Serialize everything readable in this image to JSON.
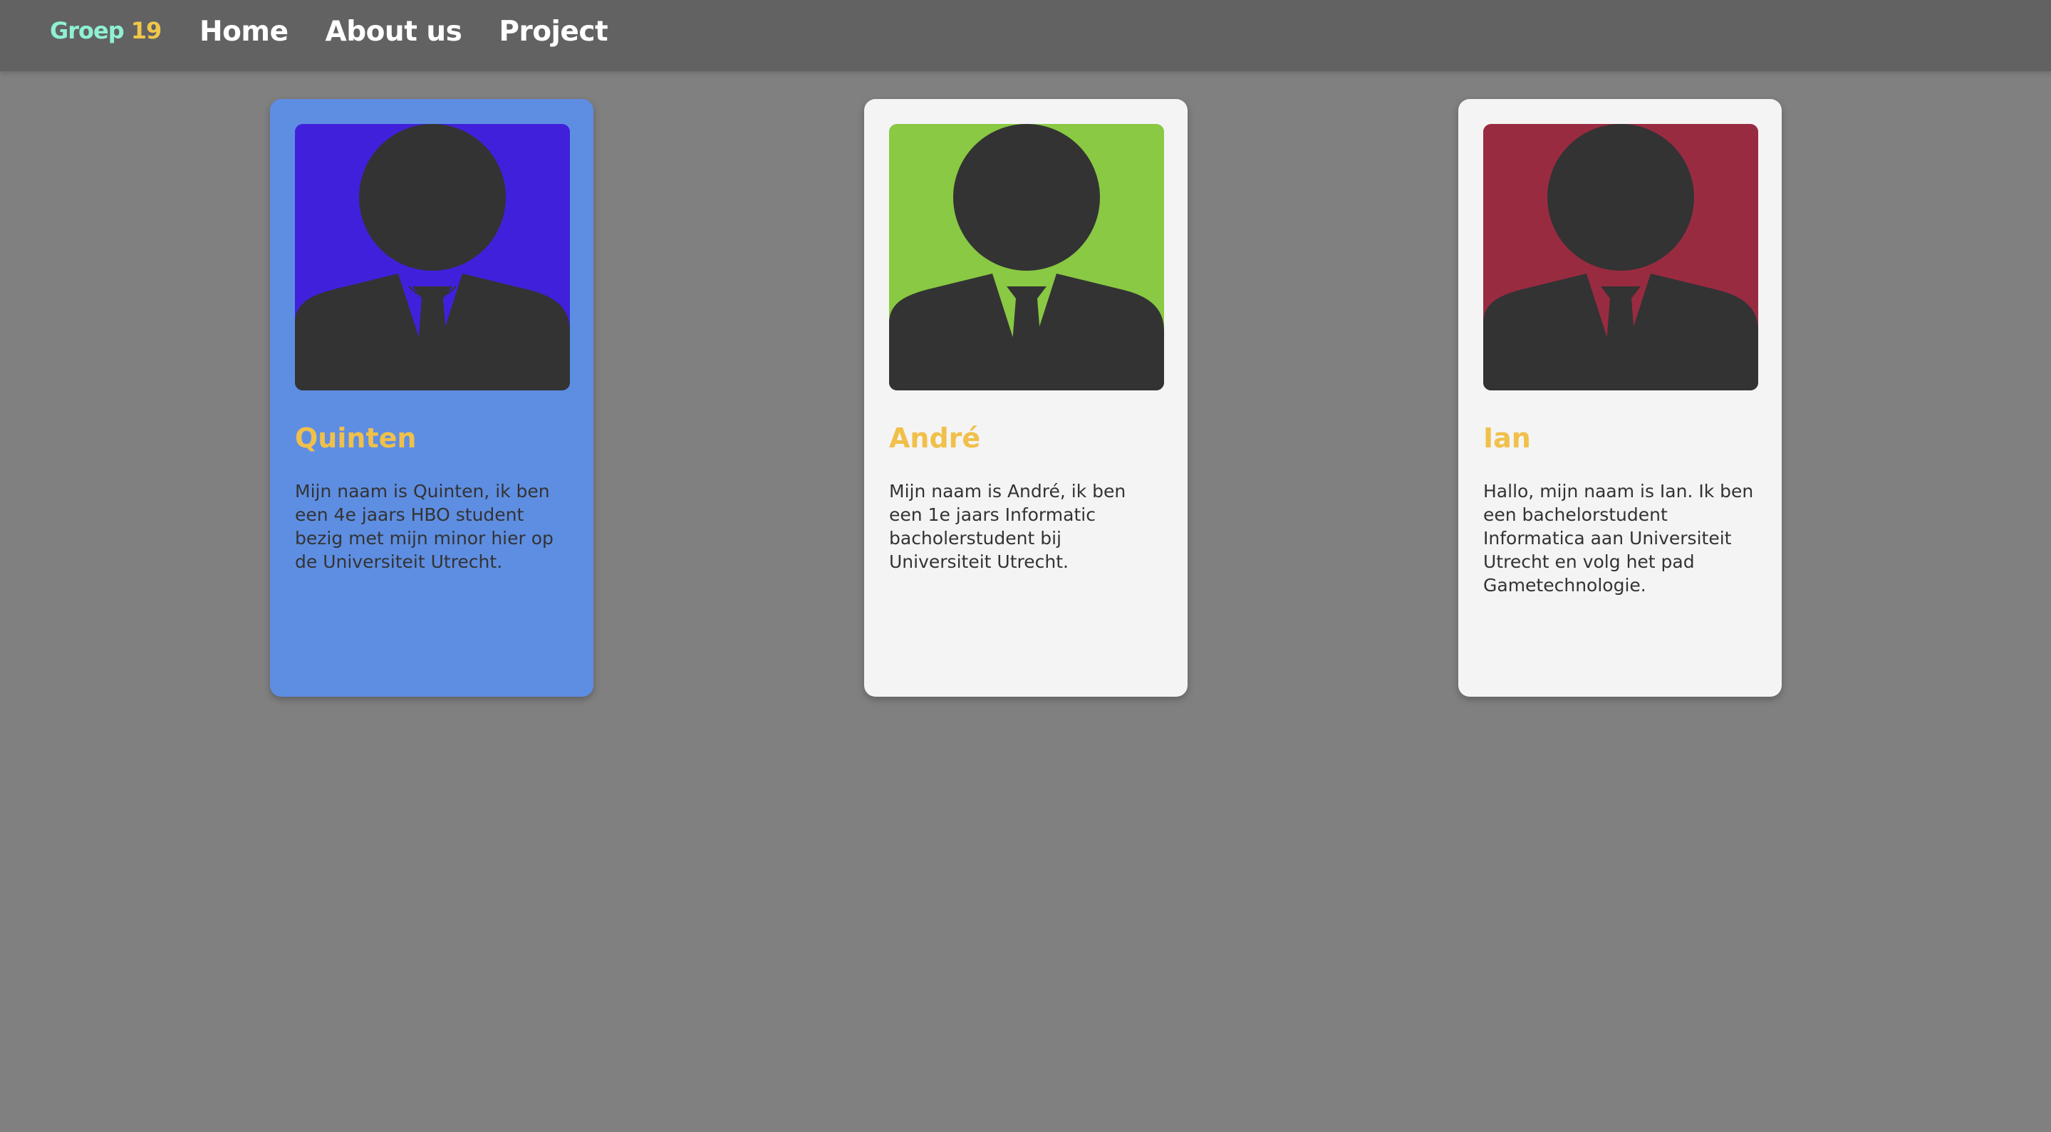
{
  "nav": {
    "logo_part1": "Groep",
    "logo_part2": "19",
    "links": [
      "Home",
      "About us",
      "Project"
    ]
  },
  "cards": [
    {
      "name": "Quinten",
      "text": "Mijn naam is Quinten, ik ben een 4e jaars HBO student bezig met mijn minor hier op de Universiteit Utrecht.",
      "avatar_bg": "#4120dc",
      "card_bg": "#5e8ee2"
    },
    {
      "name": "André",
      "text": "Mijn naam is André, ik ben een 1e jaars Informatic bacholerstudent bij Universiteit Utrecht.",
      "avatar_bg": "#89c943",
      "card_bg": "#f4f4f4"
    },
    {
      "name": "Ian",
      "text": "Hallo, mijn naam is Ian. Ik ben een bachelorstudent Informatica aan Universiteit Utrecht en volg het pad Gametechnologie.",
      "avatar_bg": "#992b41",
      "card_bg": "#f4f4f4"
    }
  ],
  "colors": {
    "page_bg": "#808080",
    "navbar_bg": "#626262",
    "name_color": "#f0c04a",
    "silhouette": "#333333"
  }
}
